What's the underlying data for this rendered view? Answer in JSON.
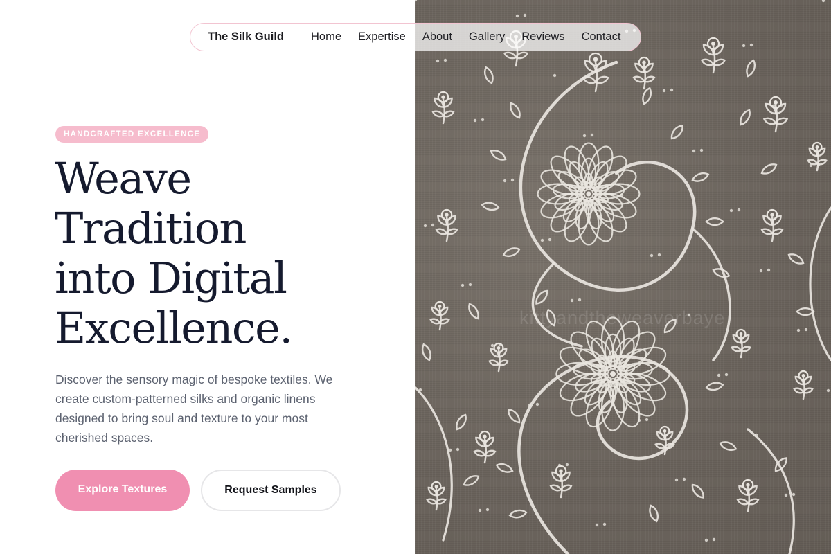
{
  "nav": {
    "brand": "The Silk Guild",
    "links": [
      "Home",
      "Expertise",
      "About",
      "Gallery",
      "Reviews",
      "Contact"
    ]
  },
  "hero": {
    "badge": "HANDCRAFTED EXCELLENCE",
    "headline_lines": [
      "Weave",
      "Tradition",
      "into Digital",
      "Excellence."
    ],
    "description": "Discover the sensory magic of bespoke textiles. We create custom-patterned silks and organic linens designed to bring soul and texture to your most cherished spaces.",
    "primary_cta": "Explore Textures",
    "secondary_cta": "Request Samples"
  },
  "image": {
    "watermark": "kittyandtheweaverbaye"
  },
  "colors": {
    "accent_pink": "#f08fb1",
    "badge_pink": "#f6bccd",
    "nav_border": "#f2c4d1",
    "heading": "#151a2e",
    "body_text": "#5c6270",
    "fabric": "#6f6861",
    "embroidery": "#e9e5df"
  }
}
